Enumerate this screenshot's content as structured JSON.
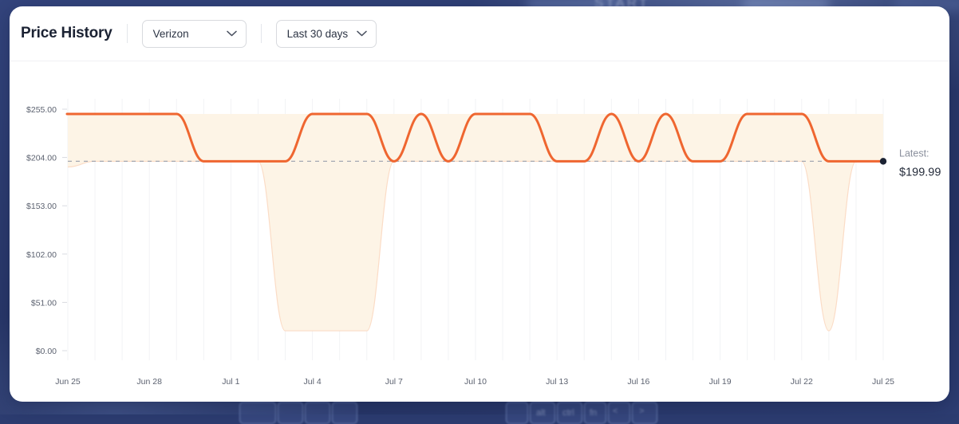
{
  "background": {
    "start_label": "START_"
  },
  "header": {
    "title": "Price History",
    "carrier_select": {
      "value": "Verizon",
      "icon": "chevron-down-icon"
    },
    "range_select": {
      "value": "Last 30 days",
      "icon": "chevron-down-icon"
    }
  },
  "annotation": {
    "caption": "Latest:",
    "value": "$199.99"
  },
  "chart_data": {
    "type": "line",
    "title": "Price History",
    "xlabel": "",
    "ylabel": "",
    "grid": "vertical",
    "legend": false,
    "ylim": [
      0,
      255
    ],
    "ytick_labels": [
      "$255.00",
      "$204.00",
      "$153.00",
      "$102.00",
      "$51.00",
      "$0.00"
    ],
    "ytick_values": [
      255,
      204,
      153,
      102,
      51,
      0
    ],
    "xtick_labels": [
      "Jun 25",
      "Jun 28",
      "Jul 1",
      "Jul 4",
      "Jul 7",
      "Jul 10",
      "Jul 13",
      "Jul 16",
      "Jul 19",
      "Jul 22",
      "Jul 25"
    ],
    "x_start": "Jun 25",
    "x_end": "Jul 25",
    "reference_line": {
      "value": 199.99,
      "style": "dashed",
      "color": "#9aa0ad"
    },
    "latest_point": {
      "x": "Jul 25",
      "y": 199.99,
      "marker": "dot",
      "color": "#1b2233"
    },
    "series": [
      {
        "name": "Price",
        "color": "#ef6630",
        "leading_segment_style": "dashed",
        "high_value": 249.99,
        "low_value": 199.99,
        "x": [
          "Jun 25",
          "Jun 26",
          "Jun 27",
          "Jun 28",
          "Jun 29",
          "Jun 30",
          "Jul 1",
          "Jul 2",
          "Jul 3",
          "Jul 4",
          "Jul 5",
          "Jul 6",
          "Jul 7",
          "Jul 8",
          "Jul 9",
          "Jul 10",
          "Jul 11",
          "Jul 12",
          "Jul 13",
          "Jul 14",
          "Jul 15",
          "Jul 16",
          "Jul 17",
          "Jul 18",
          "Jul 19",
          "Jul 20",
          "Jul 21",
          "Jul 22",
          "Jul 23",
          "Jul 24",
          "Jul 25"
        ],
        "values": [
          249.99,
          249.99,
          249.99,
          249.99,
          249.99,
          199.99,
          199.99,
          199.99,
          199.99,
          249.99,
          249.99,
          249.99,
          199.99,
          249.99,
          199.99,
          249.99,
          249.99,
          249.99,
          199.99,
          199.99,
          249.99,
          199.99,
          249.99,
          199.99,
          199.99,
          249.99,
          249.99,
          249.99,
          199.99,
          199.99,
          199.99
        ]
      },
      {
        "name": "Range band",
        "color": "#fdf4e6",
        "kind": "band",
        "upper": [
          249.99,
          249.99,
          249.99,
          249.99,
          249.99,
          249.99,
          249.99,
          249.99,
          249.99,
          249.99,
          249.99,
          249.99,
          249.99,
          249.99,
          249.99,
          249.99,
          249.99,
          249.99,
          249.99,
          249.99,
          249.99,
          249.99,
          249.99,
          249.99,
          249.99,
          249.99,
          249.99,
          249.99,
          249.99,
          249.99,
          249.99
        ],
        "lower": [
          194.0,
          199.99,
          199.99,
          199.99,
          199.99,
          199.99,
          199.99,
          199.99,
          21.0,
          21.0,
          21.0,
          21.0,
          199.99,
          199.99,
          199.99,
          199.99,
          199.99,
          199.99,
          199.99,
          199.99,
          199.99,
          199.99,
          199.99,
          199.99,
          199.99,
          199.99,
          199.99,
          199.99,
          21.0,
          199.99,
          199.99
        ]
      }
    ]
  }
}
